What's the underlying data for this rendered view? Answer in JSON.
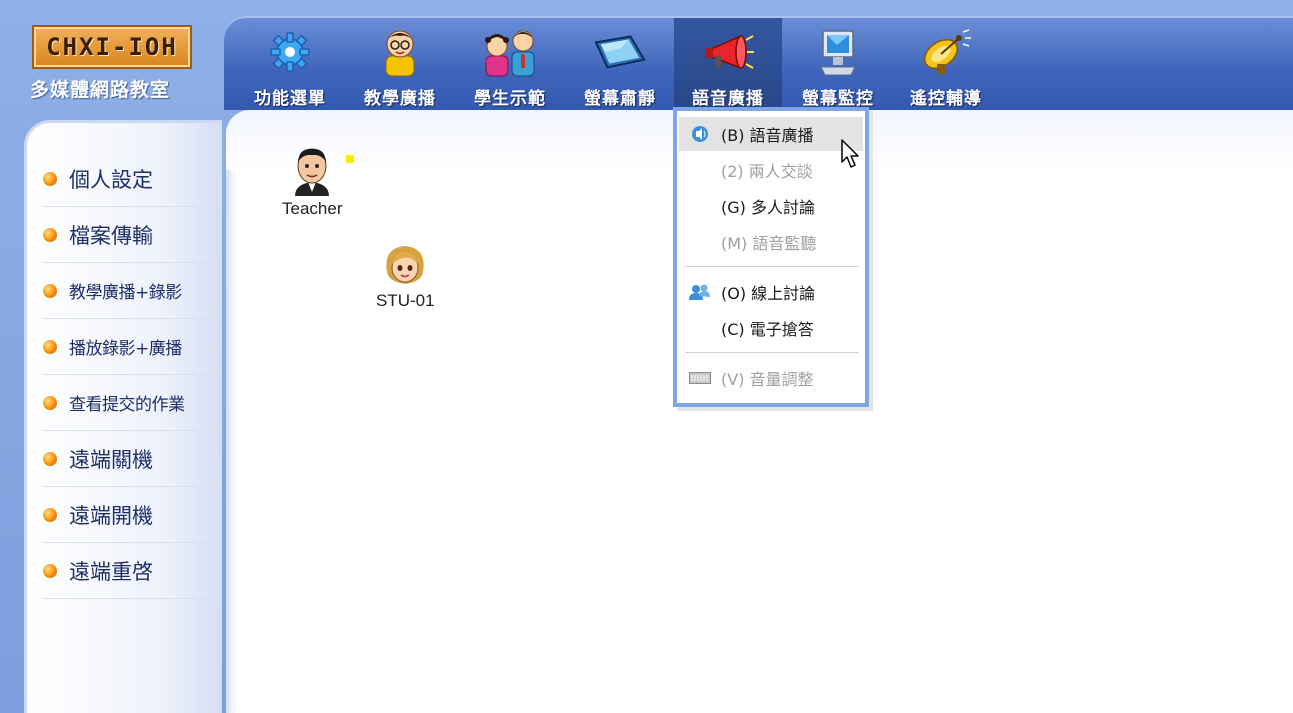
{
  "logo": {
    "mark": "CHXI-IOH",
    "subtitle": "多媒體網路教室"
  },
  "toolbar": {
    "items": [
      {
        "label": "功能選單",
        "icon": "gear-icon"
      },
      {
        "label": "教學廣播",
        "icon": "teacher-icon"
      },
      {
        "label": "學生示範",
        "icon": "students-icon"
      },
      {
        "label": "螢幕肅靜",
        "icon": "tablet-icon"
      },
      {
        "label": "語音廣播",
        "icon": "megaphone-icon"
      },
      {
        "label": "螢幕監控",
        "icon": "monitor-icon"
      },
      {
        "label": "遙控輔導",
        "icon": "satellite-dish-icon"
      }
    ]
  },
  "sidebar": {
    "items": [
      {
        "label": "個人設定"
      },
      {
        "label": "檔案傳輸"
      },
      {
        "label": "教學廣播+錄影"
      },
      {
        "label": "播放錄影+廣播"
      },
      {
        "label": "查看提交的作業"
      },
      {
        "label": "遠端關機"
      },
      {
        "label": "遠端開機"
      },
      {
        "label": "遠端重啓"
      }
    ]
  },
  "main": {
    "teacher_label": "Teacher",
    "student_label": "STU-01"
  },
  "menu": {
    "items": [
      {
        "label": "(B) 語音廣播",
        "enabled": true,
        "icon": "speaker-icon"
      },
      {
        "label": "(2) 兩人交談",
        "enabled": false
      },
      {
        "label": "(G) 多人討論",
        "enabled": true
      },
      {
        "label": "(M) 語音監聽",
        "enabled": false
      },
      {
        "label": "(O) 線上討論",
        "enabled": true,
        "icon": "users-icon"
      },
      {
        "label": "(C) 電子搶答",
        "enabled": true
      },
      {
        "label": "(V) 音量調整",
        "enabled": false,
        "icon": "volume-bar-icon"
      }
    ]
  },
  "colors": {
    "frame": "#7d9edc",
    "toolbar": "#3e64bb",
    "menu_border": "#7ea6e6",
    "bullet": "#ff9a1a"
  }
}
